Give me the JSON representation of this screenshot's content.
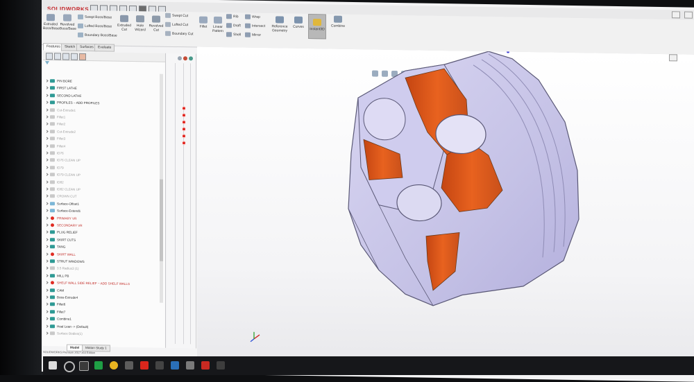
{
  "app": {
    "brand": "SOLIDWORKS"
  },
  "ribbon": {
    "groups": [
      {
        "label": "Extruded Boss/Base",
        "icon": "extruded-boss-icon"
      },
      {
        "label": "Revolved Boss/Base",
        "icon": "revolved-boss-icon"
      },
      {
        "label": "Swept Boss/Base",
        "icon": "swept-boss-icon"
      },
      {
        "label": "Lofted Boss/Base",
        "icon": "lofted-boss-icon"
      },
      {
        "label": "Boundary Boss/Base",
        "icon": "boundary-boss-icon"
      },
      {
        "label": "Extruded Cut",
        "icon": "extruded-cut-icon"
      },
      {
        "label": "Hole Wizard",
        "icon": "hole-wizard-icon"
      },
      {
        "label": "Revolved Cut",
        "icon": "revolved-cut-icon"
      },
      {
        "label": "Swept Cut",
        "icon": "swept-cut-icon"
      },
      {
        "label": "Lofted Cut",
        "icon": "lofted-cut-icon"
      },
      {
        "label": "Boundary Cut",
        "icon": "boundary-cut-icon"
      },
      {
        "label": "Fillet",
        "icon": "fillet-icon"
      },
      {
        "label": "Linear Pattern",
        "icon": "linear-pattern-icon"
      },
      {
        "label": "Rib",
        "icon": "rib-icon"
      },
      {
        "label": "Draft",
        "icon": "draft-icon"
      },
      {
        "label": "Shell",
        "icon": "shell-icon"
      },
      {
        "label": "Wrap",
        "icon": "wrap-icon"
      },
      {
        "label": "Intersect",
        "icon": "intersect-icon"
      },
      {
        "label": "Mirror",
        "icon": "mirror-icon"
      },
      {
        "label": "Reference Geometry",
        "icon": "reference-geometry-icon"
      },
      {
        "label": "Curves",
        "icon": "curves-icon"
      },
      {
        "label": "Instant3D",
        "icon": "instant3d-icon"
      },
      {
        "label": "Combine",
        "icon": "combine-icon"
      }
    ]
  },
  "command_tabs": [
    "Features",
    "Sketch",
    "Surfaces",
    "Evaluate"
  ],
  "tree": {
    "items": [
      {
        "label": "PIN BORE",
        "state": "normal"
      },
      {
        "label": "FIRST LATHE",
        "state": "normal"
      },
      {
        "label": "SECOND LATHE",
        "state": "normal"
      },
      {
        "label": "PROFILES ~ ADD PROFILES",
        "state": "normal"
      },
      {
        "label": "Cut-Extrude1",
        "state": "muted"
      },
      {
        "label": "Fillet1",
        "state": "muted"
      },
      {
        "label": "Fillet2",
        "state": "muted"
      },
      {
        "label": "Cut-Extrude2",
        "state": "muted"
      },
      {
        "label": "Fillet3",
        "state": "muted"
      },
      {
        "label": "Fillet4",
        "state": "muted"
      },
      {
        "label": "ID76",
        "state": "muted"
      },
      {
        "label": "ID76 CLEAN UP",
        "state": "muted"
      },
      {
        "label": "ID79",
        "state": "muted"
      },
      {
        "label": "ID79 CLEAN UP",
        "state": "muted"
      },
      {
        "label": "ID82",
        "state": "muted"
      },
      {
        "label": "ID82 CLEAN UP",
        "state": "muted"
      },
      {
        "label": "CROWN CUT",
        "state": "muted"
      },
      {
        "label": "Surface-Offset1",
        "state": "surf"
      },
      {
        "label": "Surface-Extend1",
        "state": "surf"
      },
      {
        "label": "PRIMARY VR",
        "state": "err"
      },
      {
        "label": "SECONDARY VR",
        "state": "err"
      },
      {
        "label": "PLUG RELIEF",
        "state": "normal"
      },
      {
        "label": "SKIRT CUTS",
        "state": "normal"
      },
      {
        "label": "TANG",
        "state": "normal"
      },
      {
        "label": "SKIRT WALL",
        "state": "err"
      },
      {
        "label": "STRUT WINDOWS",
        "state": "normal"
      },
      {
        "label": "3.5 Radius3 (1)",
        "state": "muted"
      },
      {
        "label": "MILL PB",
        "state": "normal"
      },
      {
        "label": "SHELF WALL SIDE RELIEF ~ ADD SHELF WALLS",
        "state": "err"
      },
      {
        "label": "CAM",
        "state": "normal"
      },
      {
        "label": "Boss-Extrude4",
        "state": "normal"
      },
      {
        "label": "Fillet6",
        "state": "normal"
      },
      {
        "label": "Fillet7",
        "state": "normal"
      },
      {
        "label": "Combine1",
        "state": "normal"
      },
      {
        "label": "Heal Lean -> (Default)",
        "state": "normal"
      },
      {
        "label": "Surface Bodies(1)",
        "state": "muted"
      }
    ]
  },
  "bottom_tabs": [
    "Model",
    "Motion Study 1"
  ],
  "status": "SOLIDWORKS Premium 2017 x64 Edition",
  "colors": {
    "accent": "#c32428",
    "error_dot": "#e0241d",
    "part_face": "#c9c6ea",
    "cut_face": "#e35b1d"
  }
}
